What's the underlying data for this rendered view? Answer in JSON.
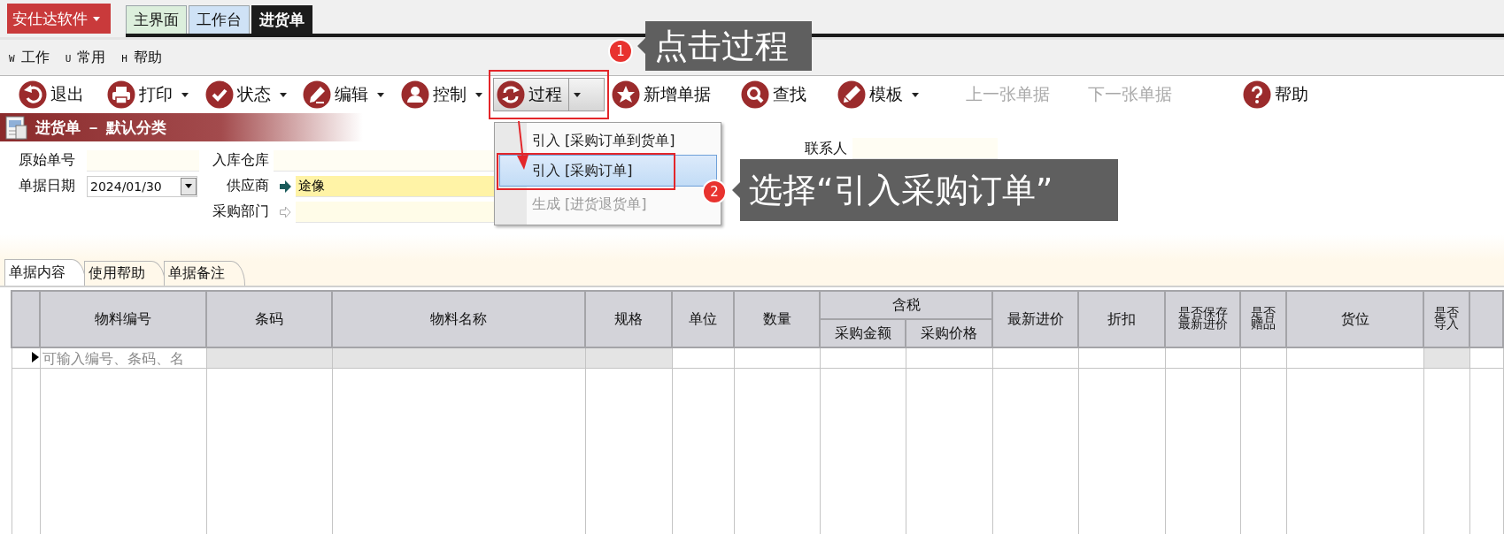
{
  "app_menu": {
    "label": "安仕达软件"
  },
  "tabs": [
    {
      "label": "主界面",
      "selected": false,
      "color": "#dcefdc"
    },
    {
      "label": "工作台",
      "selected": false,
      "color": "#cfe2f6"
    },
    {
      "label": "进货单",
      "selected": true
    }
  ],
  "menu_bar": [
    {
      "key": "W",
      "label": "工作"
    },
    {
      "key": "U",
      "label": "常用"
    },
    {
      "key": "H",
      "label": "帮助"
    }
  ],
  "toolbar": [
    {
      "label": "退出",
      "dropdown": false,
      "disabled": false,
      "pressed": false
    },
    {
      "label": "打印",
      "dropdown": true,
      "disabled": false,
      "pressed": false
    },
    {
      "label": "状态",
      "dropdown": true,
      "disabled": false,
      "pressed": false
    },
    {
      "label": "编辑",
      "dropdown": true,
      "disabled": false,
      "pressed": false
    },
    {
      "label": "控制",
      "dropdown": true,
      "disabled": false,
      "pressed": false
    },
    {
      "label": "过程",
      "dropdown": true,
      "disabled": false,
      "pressed": true
    },
    {
      "label": "新增单据",
      "dropdown": false,
      "disabled": false,
      "pressed": false
    },
    {
      "label": "查找",
      "dropdown": false,
      "disabled": false,
      "pressed": false
    },
    {
      "label": "模板",
      "dropdown": true,
      "disabled": false,
      "pressed": false
    },
    {
      "label": "上一张单据",
      "dropdown": false,
      "disabled": true,
      "pressed": false
    },
    {
      "label": "下一张单据",
      "dropdown": false,
      "disabled": true,
      "pressed": false
    },
    {
      "label": "帮助",
      "dropdown": false,
      "disabled": false,
      "pressed": false
    }
  ],
  "panel_title": "进货单 － 默认分类",
  "form": {
    "columns": [
      [
        {
          "kind": "text",
          "label": "原始单号"
        },
        {
          "kind": "date",
          "label": "单据日期",
          "value": "2024/01/30"
        }
      ],
      [
        {
          "kind": "text",
          "label": "入库仓库"
        },
        {
          "kind": "lookup",
          "label": "供应商",
          "value": "途像",
          "required": true
        },
        {
          "kind": "lookup",
          "label": "采购部门",
          "required": false
        }
      ],
      [
        {
          "kind": "text",
          "label": "联系人"
        }
      ]
    ]
  },
  "process_menu": {
    "items": [
      {
        "label": "引入 [采购订单到货单]",
        "selected": false,
        "disabled": false
      },
      {
        "label": "引入 [采购订单]",
        "selected": true,
        "disabled": false
      },
      {
        "label": "生成 [进货退货单]",
        "selected": false,
        "disabled": true
      }
    ]
  },
  "callouts": [
    {
      "number": "1",
      "text": "点击过程"
    },
    {
      "number": "2",
      "text": "选择“引入采购订单”"
    }
  ],
  "doc_tabs": [
    {
      "label": "单据内容",
      "selected": true
    },
    {
      "label": "使用帮助",
      "selected": false
    },
    {
      "label": "单据备注",
      "selected": false
    }
  ],
  "table": {
    "columns": [
      {
        "label": "物料编号",
        "readonly": false
      },
      {
        "label": "条码",
        "readonly": true
      },
      {
        "label": "物料名称",
        "readonly": true
      },
      {
        "label": "规格",
        "readonly": true
      },
      {
        "label": "单位",
        "readonly": false
      },
      {
        "label": "数量",
        "readonly": false
      },
      {
        "label": "含税",
        "children": [
          {
            "label": "采购金额",
            "readonly": false
          },
          {
            "label": "采购价格",
            "readonly": false
          }
        ]
      },
      {
        "label": "最新进价",
        "readonly": false
      },
      {
        "label": "折扣",
        "readonly": false
      },
      {
        "label": "是否保存最新进价",
        "readonly": false
      },
      {
        "label": "是否赠品",
        "readonly": false
      },
      {
        "label": "货位",
        "readonly": false
      },
      {
        "label": "是否导入",
        "readonly": true
      }
    ],
    "rows": [
      {
        "current": true,
        "placeholder": "可输入编号、条码、名"
      }
    ]
  }
}
